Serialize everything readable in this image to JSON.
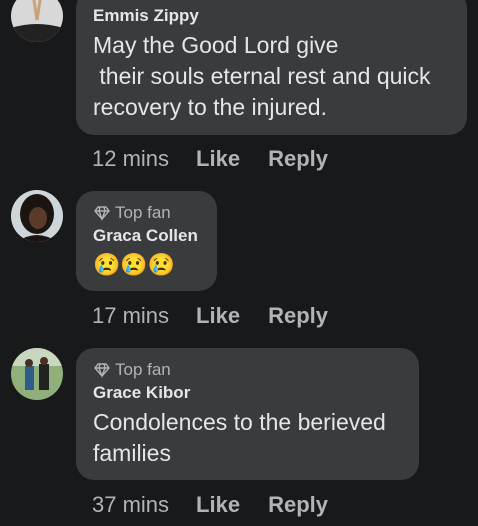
{
  "comments": [
    {
      "author": "Emmis Zippy",
      "text": "May the Good Lord give\n their souls eternal rest and quick recovery to the injured.",
      "time": "12 mins",
      "like": "Like",
      "reply": "Reply"
    },
    {
      "badge": "Top fan",
      "author": "Graca Collen",
      "text": "😢😢😢",
      "time": "17 mins",
      "like": "Like",
      "reply": "Reply"
    },
    {
      "badge": "Top fan",
      "author": "Grace Kibor",
      "text": "Condolences to the berieved families",
      "time": "37 mins",
      "like": "Like",
      "reply": "Reply"
    }
  ],
  "icons": {
    "top_fan": "diamond-icon"
  },
  "colors": {
    "background": "#18191a",
    "bubble": "#3a3b3c",
    "muted": "#b0b3b8",
    "text": "#e4e6eb"
  }
}
